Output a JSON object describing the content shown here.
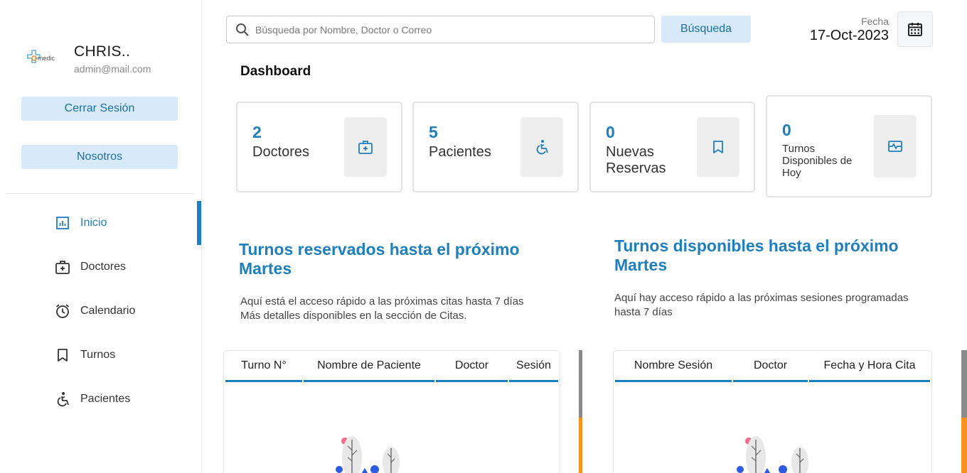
{
  "profile": {
    "name": "CHRIS..",
    "email": "admin@mail.com",
    "logo_text": "medic"
  },
  "sidebar": {
    "logout_label": "Cerrar Sesión",
    "about_label": "Nosotros",
    "items": [
      {
        "label": "Inicio",
        "icon": "chart-icon",
        "active": true
      },
      {
        "label": "Doctores",
        "icon": "medical-bag-icon",
        "active": false
      },
      {
        "label": "Calendario",
        "icon": "alarm-clock-icon",
        "active": false
      },
      {
        "label": "Turnos",
        "icon": "bookmark-icon",
        "active": false
      },
      {
        "label": "Pacientes",
        "icon": "accessible-icon",
        "active": false
      }
    ]
  },
  "search": {
    "placeholder": "Búsqueda por Nombre, Doctor o Correo",
    "value": "",
    "button_label": "Búsqueda"
  },
  "date": {
    "label": "Fecha",
    "value": "17-Oct-2023"
  },
  "dashboard": {
    "title": "Dashboard"
  },
  "stats": [
    {
      "value": "2",
      "label": "Doctores",
      "icon": "medical-bag-icon"
    },
    {
      "value": "5",
      "label": "Pacientes",
      "icon": "accessible-icon"
    },
    {
      "value": "0",
      "label": "Nuevas Reservas",
      "icon": "bookmark-icon"
    },
    {
      "value": "0",
      "label": "Turnos Disponibles de Hoy",
      "icon": "schedule-icon"
    }
  ],
  "sections": {
    "booked": {
      "title": "Turnos reservados hasta el próximo Martes",
      "desc": "Aquí está el acceso rápido a las próximas citas hasta 7 días Más detalles disponibles en la sección de Citas.",
      "columns": [
        "Turno N°",
        "Nombre de Paciente",
        "Doctor",
        "Sesión"
      ]
    },
    "available": {
      "title": "Turnos disponibles hasta el próximo Martes",
      "desc": "Aquí hay acceso rápido a las próximas sesiones programadas hasta 7 días",
      "columns": [
        "Nombre Sesión",
        "Doctor",
        "Fecha y Hora Cita"
      ]
    }
  },
  "colors": {
    "accent": "#1e7fbd",
    "button_bg": "#d8eaf9",
    "scroll_thumb": "#f7921e"
  }
}
